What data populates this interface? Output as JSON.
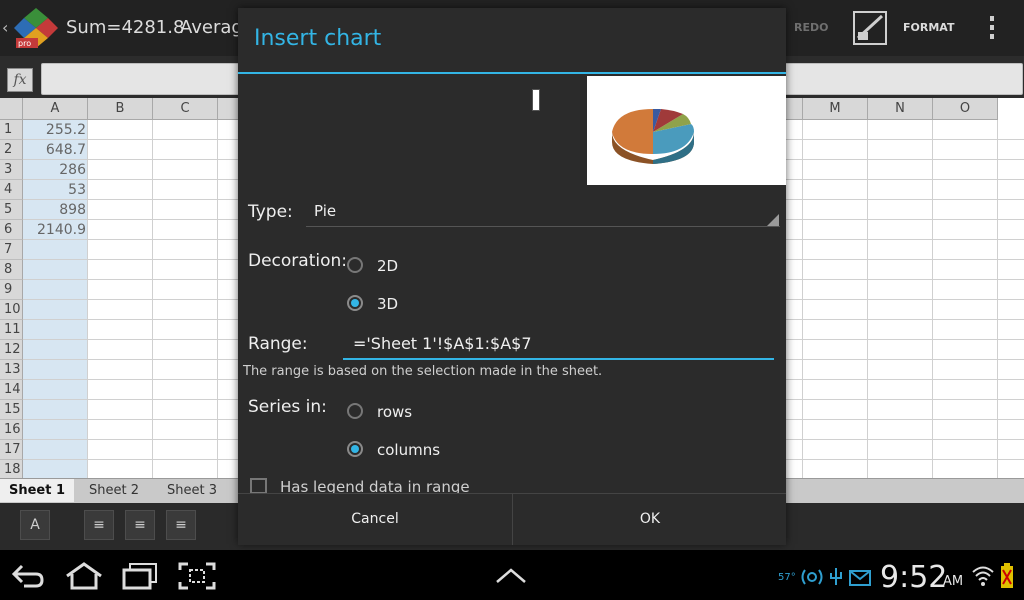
{
  "actionbar": {
    "status_sum": "Sum=4281.8",
    "status_avg": "Average",
    "redo_label": "REDO",
    "format_label": "FORMAT"
  },
  "formula_bar": {
    "fx_label": "fx",
    "value": ""
  },
  "grid": {
    "columns": [
      "A",
      "B",
      "C",
      "",
      "",
      "",
      "",
      "",
      "",
      "",
      "",
      "",
      "M",
      "N",
      "O"
    ],
    "rows": [
      "1",
      "2",
      "3",
      "4",
      "5",
      "6",
      "7",
      "8",
      "9",
      "10",
      "11",
      "12",
      "13",
      "14",
      "15",
      "16",
      "17",
      "18"
    ],
    "col_a_values": [
      "255.2",
      "648.7",
      "286",
      "53",
      "898",
      "2140.9"
    ]
  },
  "sheet_tabs": [
    "Sheet 1",
    "Sheet 2",
    "Sheet 3"
  ],
  "dialog": {
    "title": "Insert chart",
    "type_label": "Type:",
    "type_value": "Pie",
    "decoration_label": "Decoration:",
    "decoration_options": [
      "2D",
      "3D"
    ],
    "decoration_selected": "3D",
    "range_label": "Range:",
    "range_value": "='Sheet 1'!$A$1:$A$7",
    "range_help": "The range is based on the selection made in the sheet.",
    "series_label": "Series in:",
    "series_options": [
      "rows",
      "columns"
    ],
    "series_selected": "columns",
    "legend_label": "Has legend data in range",
    "cancel_label": "Cancel",
    "ok_label": "OK"
  },
  "statusbar": {
    "temperature": "57°",
    "time": "9:52",
    "ampm": "AM"
  },
  "colors": {
    "accent": "#33b5e5",
    "dialog_bg": "#2b2b2b",
    "pie_colors": [
      "#d17a3a",
      "#4a9bbd",
      "#a03a3a",
      "#8fa24a",
      "#3a5aa0"
    ]
  }
}
